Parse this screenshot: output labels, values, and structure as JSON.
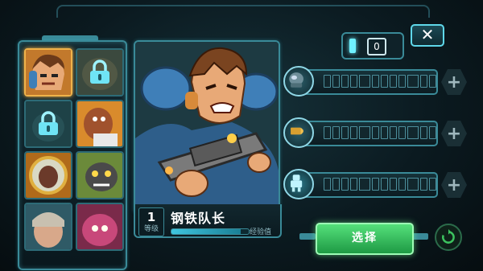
{
  "colors": {
    "accent": "#3a8a98",
    "highlight": "#f0b24a",
    "confirm": "#3cc35f"
  },
  "header": {
    "tab_label": "0",
    "close_icon": "close-icon",
    "close_label": "✕"
  },
  "roster": {
    "heroes": [
      {
        "id": "captain",
        "selected": true,
        "locked": false
      },
      {
        "id": "brute",
        "selected": false,
        "locked": true
      },
      {
        "id": "tank",
        "selected": false,
        "locked": true
      },
      {
        "id": "medic",
        "selected": false,
        "locked": false
      },
      {
        "id": "diver",
        "selected": false,
        "locked": false
      },
      {
        "id": "rocket",
        "selected": false,
        "locked": false
      },
      {
        "id": "scout",
        "selected": false,
        "locked": false
      },
      {
        "id": "mutant",
        "selected": false,
        "locked": false
      }
    ]
  },
  "hero": {
    "level": "1",
    "level_label": "等级",
    "name": "钢铁队长",
    "xp_label": "经验值",
    "xp_progress": 0.9
  },
  "upgrades": [
    {
      "icon": "armor-bust-icon",
      "segments": 12
    },
    {
      "icon": "bullet-icon",
      "segments": 12
    },
    {
      "icon": "mech-robot-icon",
      "segments": 12
    }
  ],
  "actions": {
    "select_label": "选择",
    "refresh_icon": "refresh-icon"
  }
}
